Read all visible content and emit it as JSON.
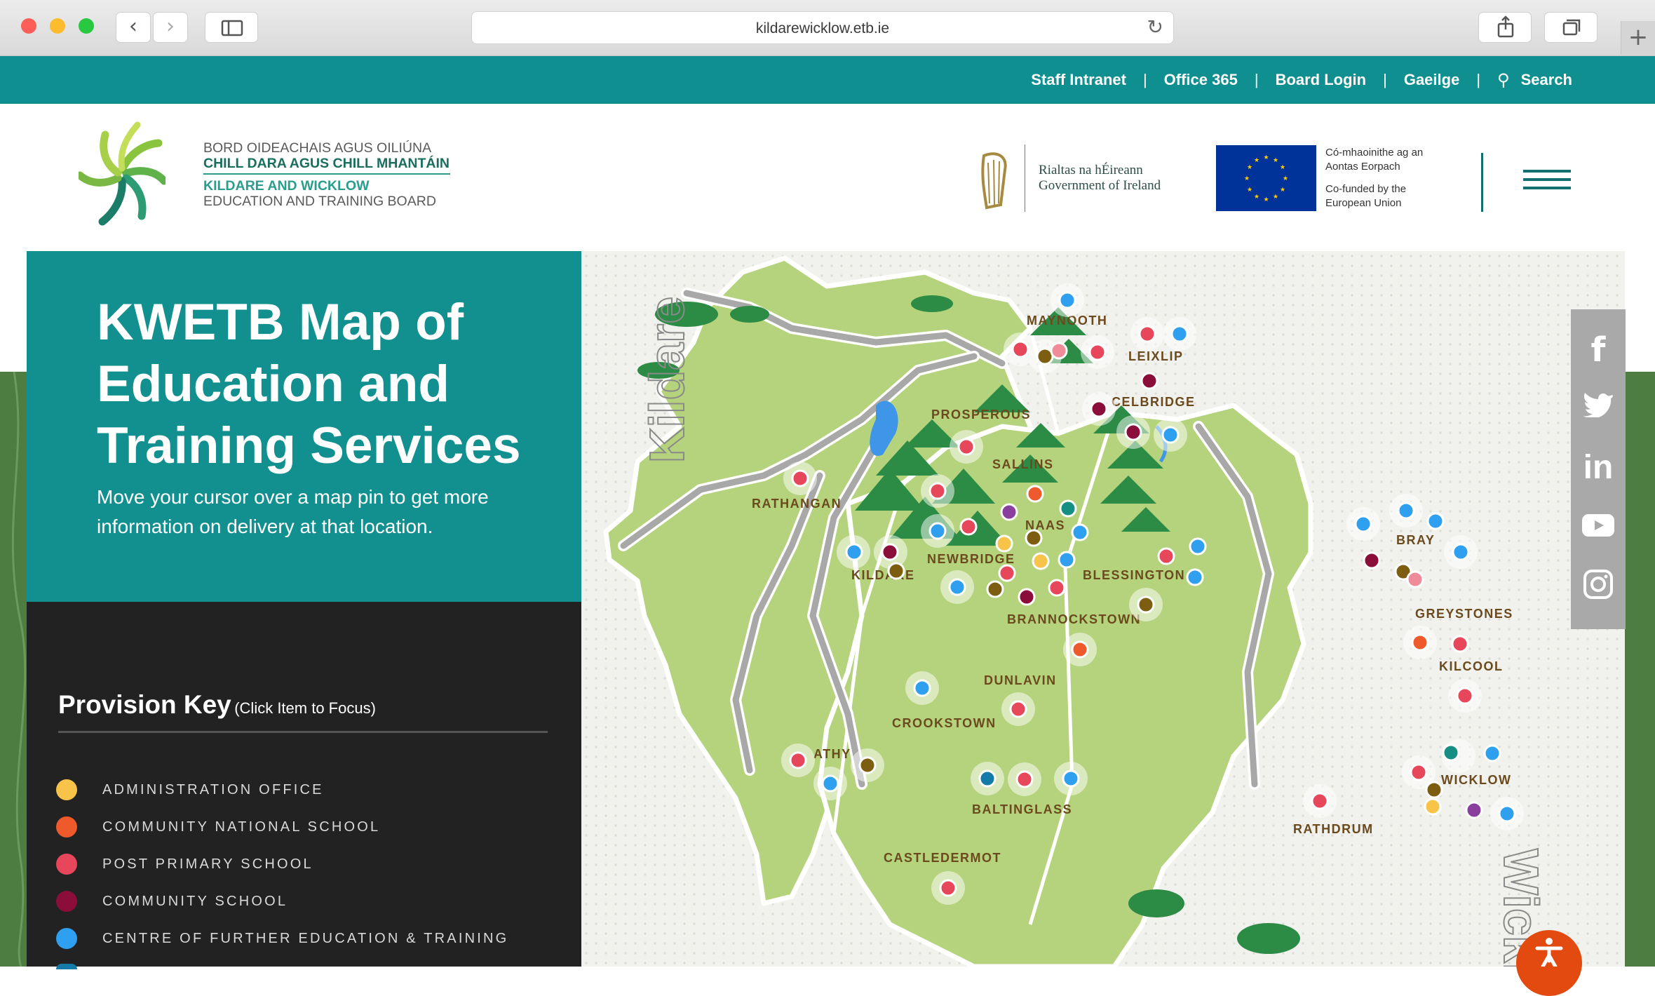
{
  "browser": {
    "url": "kildarewicklow.etb.ie"
  },
  "topbar": {
    "links": [
      "Staff Intranet",
      "Office 365",
      "Board Login",
      "Gaeilge"
    ],
    "search_label": "Search"
  },
  "header": {
    "logo_line1": "BORD OIDEACHAIS AGUS OILIÚNA",
    "logo_line2": "CHILL DARA AGUS CHILL MHANTÁIN",
    "logo_line3": "KILDARE AND WICKLOW",
    "logo_line4": "EDUCATION AND TRAINING BOARD",
    "gov_line1": "Rialtas na hÉireann",
    "gov_line2": "Government of Ireland",
    "eu_line1": "Có-mhaoinithe ag an",
    "eu_line2": "Aontas Eorpach",
    "eu_line3": "Co-funded by the",
    "eu_line4": "European Union"
  },
  "hero": {
    "title": "KWETB Map of Education and Training Services",
    "subtitle": "Move your cursor over a map pin to get more information on delivery at that location."
  },
  "provision_key": {
    "title": "Provision Key",
    "hint": "(Click Item to Focus)",
    "items": [
      {
        "label": "ADMINISTRATION OFFICE",
        "color": "#f8c349"
      },
      {
        "label": "COMMUNITY NATIONAL SCHOOL",
        "color": "#ef5a2c"
      },
      {
        "label": "POST PRIMARY SCHOOL",
        "color": "#e6475a"
      },
      {
        "label": "COMMUNITY SCHOOL",
        "color": "#8a0d3a"
      },
      {
        "label": "CENTRE OF FURTHER EDUCATION & TRAINING",
        "color": "#2f9ff0"
      }
    ]
  },
  "map": {
    "county_labels": [
      "Kildare",
      "Wicklow"
    ],
    "towns": [
      "MAYNOOTH",
      "LEIXLIP",
      "CELBRIDGE",
      "PROSPEROUS",
      "SALLINS",
      "RATHANGAN",
      "NAAS",
      "NEWBRIDGE",
      "KILDARE",
      "BLESSINGTON",
      "BRANNOCKSTOWN",
      "BRAY",
      "GREYSTONES",
      "KILCOOL",
      "DUNLAVIN",
      "CROOKSTOWN",
      "ATHY",
      "BALTINGLASS",
      "WICKLOW",
      "RATHDRUM",
      "CASTLEDERMOT"
    ]
  },
  "social": {
    "icons": [
      "facebook-icon",
      "twitter-icon",
      "linkedin-icon",
      "youtube-icon",
      "instagram-icon"
    ]
  },
  "colors": {
    "teal": "#0f8f8f",
    "dark_panel": "#222222",
    "map_green": "#b5d37c",
    "forest_green": "#2c8b45"
  }
}
